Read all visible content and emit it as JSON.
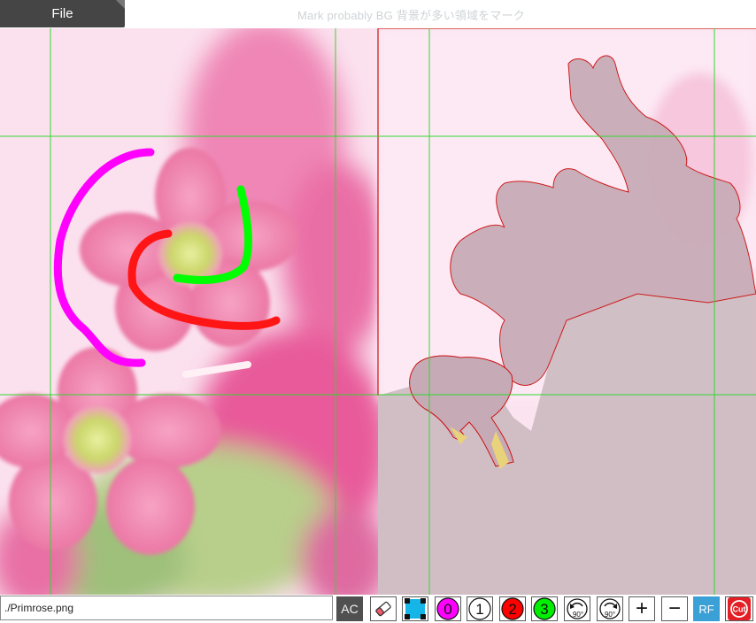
{
  "header": {
    "file_label": "File",
    "hint": "Mark probably BG 背景が多い領域をマーク"
  },
  "footer": {
    "filename": "./Primrose.png",
    "tools": {
      "ac": "AC",
      "brush_0": "0",
      "brush_1": "1",
      "brush_2": "2",
      "brush_3": "3",
      "rotate_ccw": "90°",
      "rotate_cw": "90°",
      "zoom_in": "+",
      "zoom_out": "−",
      "rf": "RF",
      "cut": "Cut"
    }
  },
  "colors": {
    "brush_0": "#ff00ff",
    "brush_1": "#ffffff",
    "brush_2": "#ff0000",
    "brush_3": "#00ff00",
    "grid": "#33d633",
    "selection_outline": "#cc1111",
    "accent_blue": "#3aa0d5"
  },
  "icons": {
    "eraser": "eraser-icon",
    "select": "select-area-icon",
    "rotate_ccw": "rotate-left-icon",
    "rotate_cw": "rotate-right-icon",
    "cut": "cut-icon"
  }
}
